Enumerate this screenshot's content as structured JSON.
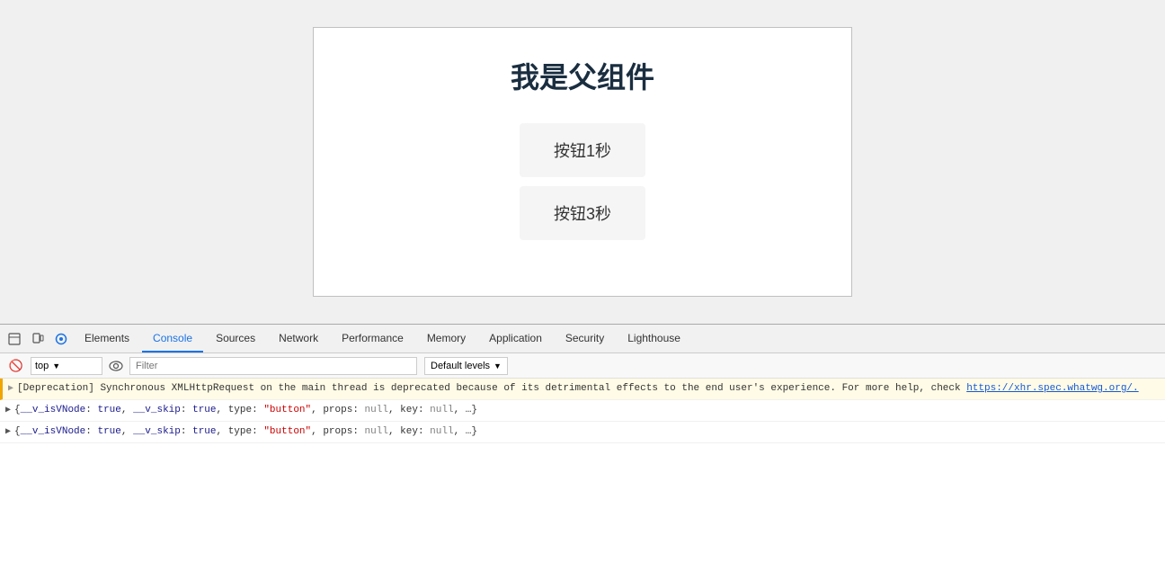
{
  "app": {
    "title": "我是父组件",
    "buttons": [
      {
        "label": "按钮1秒"
      },
      {
        "label": "按钮3秒"
      }
    ]
  },
  "devtools": {
    "tabs": [
      {
        "label": "Elements",
        "active": false
      },
      {
        "label": "Console",
        "active": true
      },
      {
        "label": "Sources",
        "active": false
      },
      {
        "label": "Network",
        "active": false
      },
      {
        "label": "Performance",
        "active": false
      },
      {
        "label": "Memory",
        "active": false
      },
      {
        "label": "Application",
        "active": false
      },
      {
        "label": "Security",
        "active": false
      },
      {
        "label": "Lighthouse",
        "active": false
      }
    ],
    "console": {
      "context_label": "top",
      "filter_placeholder": "Filter",
      "levels_label": "Default levels",
      "logs": [
        {
          "type": "warning",
          "arrow": "▶",
          "text": "[Deprecation] Synchronous XMLHttpRequest on the main thread is deprecated because of its detrimental effects to the end user's experience. For more help, check ",
          "link": "https://xhr.spec.whatwg.org/.",
          "has_link": true
        },
        {
          "type": "info",
          "arrow": "▶",
          "text": "{__v_isVNode: true, __v_skip: true, type: \"button\", props: null, key: null, …}",
          "has_link": false
        },
        {
          "type": "info",
          "arrow": "▶",
          "text": "{__v_isVNode: true, __v_skip: true, type: \"button\", props: null, key: null, …}",
          "has_link": false
        }
      ]
    }
  }
}
